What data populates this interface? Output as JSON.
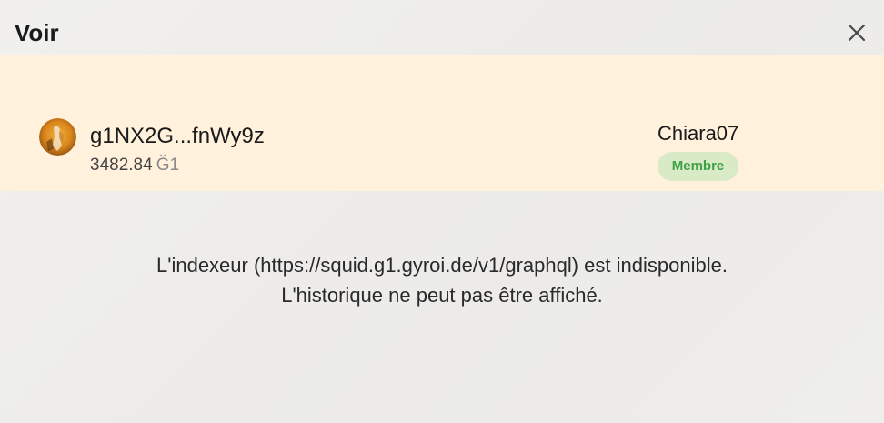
{
  "dialog": {
    "title": "Voir",
    "close_icon": "close-icon"
  },
  "account": {
    "avatar_icon": "user-avatar",
    "address": "g1NX2G...fnWy9z",
    "balance_value": "3482.84",
    "balance_unit": "Ğ1",
    "username": "Chiara07",
    "status_badge": "Membre",
    "card_color": "#fff1dc",
    "badge_color": "#d9ebc6",
    "badge_text_color": "#3fa046"
  },
  "history": {
    "error_line1": "L'indexeur (https://squid.g1.gyroi.de/v1/graphql) est indisponible.",
    "error_line2": "L'historique ne peut pas être affiché."
  }
}
